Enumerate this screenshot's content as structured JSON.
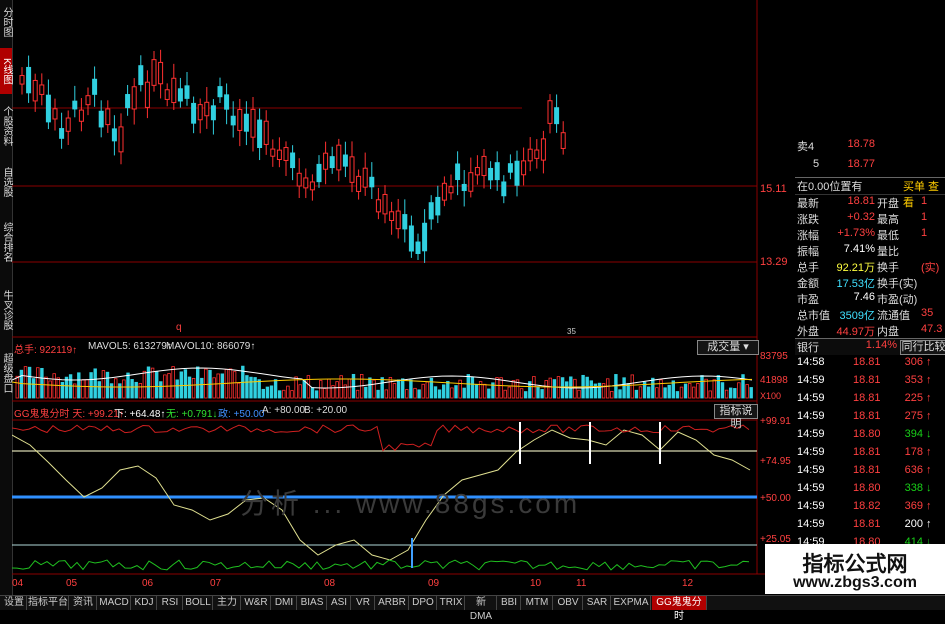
{
  "left_tabs": [
    {
      "label": "分时图",
      "active": false
    },
    {
      "label": "K线图",
      "active": true
    },
    {
      "label": "个股资料",
      "active": false
    },
    {
      "label": "自选股",
      "active": false
    },
    {
      "label": "综合排名",
      "active": false
    },
    {
      "label": "牛叉诊股",
      "active": false
    },
    {
      "label": "超级盘口",
      "active": false
    }
  ],
  "price_axis": {
    "high": "15.11",
    "low": "13.29"
  },
  "chart_markers": {
    "left": "q",
    "mid": "35"
  },
  "volume_header": {
    "label_total": "总手: 922119↑",
    "mavol5": "MAVOL5: 613279↑",
    "mavol10": "MAVOL10: 866079↑",
    "dropdown": "成交量",
    "axis_top": "83795",
    "axis_mid": "41898",
    "axis_unit": "X100"
  },
  "indicator_header": {
    "name": "GG鬼鬼分时 天: +99.21↑",
    "down": "下: +64.48↑",
    "wu": "无: +0.791↓",
    "zheng": "政: +50.00",
    "a": "A: +80.00",
    "b": "B: +20.00",
    "button": "指标说明",
    "axis": [
      "+99.91",
      "+74.95",
      "+50.00",
      "+25.05"
    ]
  },
  "date_axis": [
    "04",
    "05",
    "06",
    "07",
    "08",
    "09",
    "10",
    "11",
    "12"
  ],
  "watermark": "分析 ... www.88gs.com",
  "quote": {
    "row4": {
      "label": "卖4",
      "price": "18.78",
      "vol": ""
    },
    "row5": {
      "label": "5",
      "price": "18.77",
      "vol": ""
    },
    "header_left": "在0.00位置有",
    "header_right": "买单  查看",
    "rows": [
      {
        "k": "最新",
        "v": "18.81",
        "vc": "red",
        "k2": "开盘",
        "v2": "1"
      },
      {
        "k": "涨跌",
        "v": "+0.32",
        "vc": "red",
        "k2": "最高",
        "v2": "1"
      },
      {
        "k": "涨幅",
        "v": "+1.73%",
        "vc": "red",
        "k2": "最低",
        "v2": "1"
      },
      {
        "k": "振幅",
        "v": "7.41%",
        "vc": "white",
        "k2": "量比",
        "v2": ""
      },
      {
        "k": "总手",
        "v": "92.21万",
        "vc": "yellow",
        "k2": "换手",
        "v2": "(实)"
      },
      {
        "k": "金额",
        "v": "17.53亿",
        "vc": "cyan",
        "k2": "换手(实)",
        "v2": ""
      },
      {
        "k": "市盈",
        "v": "7.46",
        "vc": "white",
        "k2": "市盈(动)",
        "v2": ""
      },
      {
        "k": "总市值",
        "v": "3509亿",
        "vc": "cyan",
        "k2": "流通值",
        "v2": "35"
      },
      {
        "k": "外盘",
        "v": "44.97万",
        "vc": "red",
        "k2": "内盘",
        "v2": "47.3"
      }
    ],
    "sector": "银行",
    "sector_pct": "1.14%",
    "sector_btn": "同行比较"
  },
  "ticks": [
    {
      "t": "14:58",
      "p": "18.81",
      "q": "306",
      "a": "↑",
      "dir": "up"
    },
    {
      "t": "14:59",
      "p": "18.81",
      "q": "353",
      "a": "↑",
      "dir": "up"
    },
    {
      "t": "14:59",
      "p": "18.81",
      "q": "225",
      "a": "↑",
      "dir": "up"
    },
    {
      "t": "14:59",
      "p": "18.81",
      "q": "275",
      "a": "↑",
      "dir": "up"
    },
    {
      "t": "14:59",
      "p": "18.80",
      "q": "394",
      "a": "↓",
      "dir": "down"
    },
    {
      "t": "14:59",
      "p": "18.81",
      "q": "178",
      "a": "↑",
      "dir": "up"
    },
    {
      "t": "14:59",
      "p": "18.81",
      "q": "636",
      "a": "↑",
      "dir": "up"
    },
    {
      "t": "14:59",
      "p": "18.80",
      "q": "338",
      "a": "↓",
      "dir": "down"
    },
    {
      "t": "14:59",
      "p": "18.82",
      "q": "369",
      "a": "↑",
      "dir": "up"
    },
    {
      "t": "14:59",
      "p": "18.81",
      "q": "200",
      "a": "↑",
      "dir": "flat"
    },
    {
      "t": "14:59",
      "p": "18.80",
      "q": "414",
      "a": "↓",
      "dir": "down"
    }
  ],
  "bottom_tabs": [
    "设置",
    "指标平台",
    "资讯",
    "MACD",
    "KDJ",
    "RSI",
    "BOLL",
    "主力",
    "W&R",
    "DMI",
    "BIAS",
    "ASI",
    "VR",
    "ARBR",
    "DPO",
    "TRIX",
    "新DMA",
    "BBI",
    "MTM",
    "OBV",
    "SAR",
    "EXPMA",
    "GG鬼鬼分时"
  ],
  "badge": {
    "title": "指标公式网",
    "url": "www.zbgs3.com"
  },
  "colors": {
    "up": "#ff3030",
    "down": "#30d0e0",
    "ma": "#e8e8e8",
    "grid": "#8a0000",
    "indicator_line": "#e0e090",
    "green_line": "#20c020",
    "blue_line": "#3090ff"
  }
}
